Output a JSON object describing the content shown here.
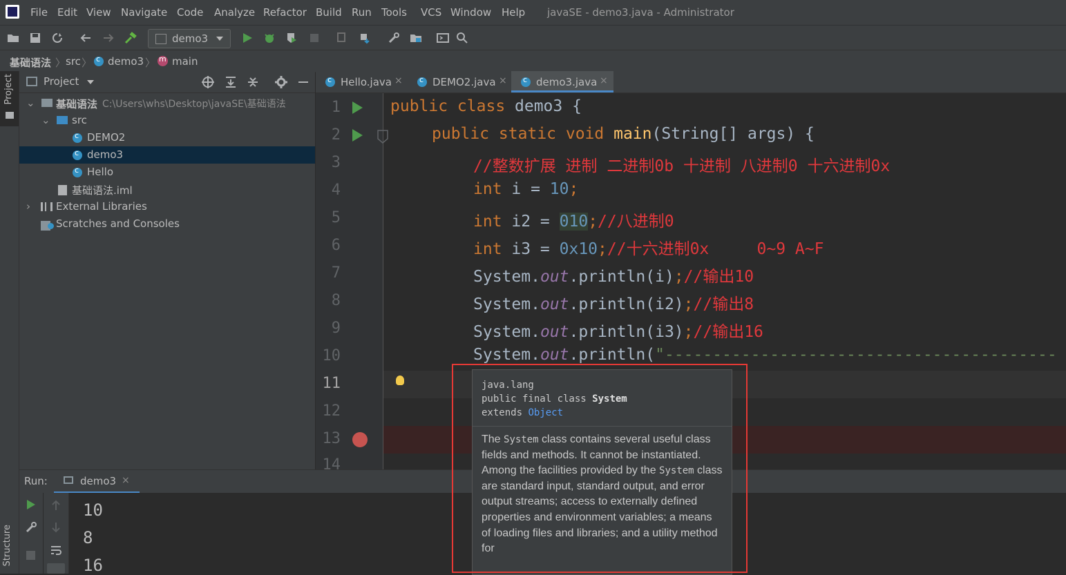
{
  "menu": {
    "items": [
      "File",
      "Edit",
      "View",
      "Navigate",
      "Code",
      "Analyze",
      "Refactor",
      "Build",
      "Run",
      "Tools",
      "VCS",
      "Window",
      "Help"
    ],
    "window_title": "javaSE - demo3.java - Administrator"
  },
  "toolbar": {
    "run_config": "demo3"
  },
  "breadcrumb": {
    "items": [
      "基础语法",
      "src",
      "demo3",
      "main"
    ]
  },
  "sidebar": {
    "project_tab": "Project",
    "structure_tab": "Structure"
  },
  "project_panel": {
    "title": "Project",
    "root_name": "基础语法",
    "root_path": "C:\\Users\\whs\\Desktop\\javaSE\\基础语法",
    "src": "src",
    "files": [
      "DEMO2",
      "demo3",
      "Hello"
    ],
    "iml": "基础语法.iml",
    "external_libraries": "External Libraries",
    "scratches": "Scratches and Consoles"
  },
  "editor_tabs": [
    {
      "label": "Hello.java"
    },
    {
      "label": "DEMO2.java"
    },
    {
      "label": "demo3.java",
      "active": true
    }
  ],
  "line_numbers": [
    "1",
    "2",
    "3",
    "4",
    "5",
    "6",
    "7",
    "8",
    "9",
    "10",
    "11",
    "12",
    "13",
    "14"
  ],
  "code": {
    "l1": {
      "kw": "public class ",
      "name": "demo3 {"
    },
    "l2": {
      "kw": "public static void ",
      "fn": "main",
      "rest": "(String[] args) {"
    },
    "l3": {
      "comment": "//整数扩展 进制 二进制0b 十进制 八进制0 十六进制0x"
    },
    "l4": {
      "kw": "int ",
      "var": "i = ",
      "num": "10",
      "semi": ";"
    },
    "l5": {
      "kw": "int ",
      "var": "i2 = ",
      "num": "010",
      "semi": ";",
      "comment": "//八进制0"
    },
    "l6": {
      "kw": "int ",
      "var": "i3 = ",
      "num": "0x10",
      "semi": ";",
      "comment": "//十六进制0x     0~9 A~F"
    },
    "l7": {
      "a": "System.",
      "fld": "out",
      "b": ".println(i)",
      "semi": ";",
      "comment": "//输出10"
    },
    "l8": {
      "a": "System.",
      "fld": "out",
      "b": ".println(i2)",
      "semi": ";",
      "comment": "//输出8"
    },
    "l9": {
      "a": "System.",
      "fld": "out",
      "b": ".println(i3)",
      "semi": ";",
      "comment": "//输出16"
    },
    "l10": {
      "a": "System.",
      "fld": "out",
      "b": ".println(",
      "str": "\"-----------------------------------------"
    }
  },
  "run_panel": {
    "label": "Run:",
    "tab": "demo3",
    "output": [
      "10",
      "8",
      "16"
    ]
  },
  "doc_popup": {
    "package": "java.lang",
    "decl_prefix": "public final class ",
    "decl_name": "System",
    "extends_kw": "extends ",
    "extends_link": "Object",
    "body_1a": "The ",
    "body_1b": "System",
    "body_1c": " class contains several useful class fields and methods. It cannot be instantiated.",
    "body_2a": "Among the facilities provided by the ",
    "body_2b": "System",
    "body_2c": " class are standard input, standard output, and error output streams; access to externally defined properties and environment variables; a means of loading files and libraries; and a utility method for"
  },
  "colors": {
    "keyword": "#cc7832",
    "comment": "#e0383c",
    "number": "#6897bb",
    "highlight_box": "#e53935",
    "selection": "#0d293e"
  }
}
